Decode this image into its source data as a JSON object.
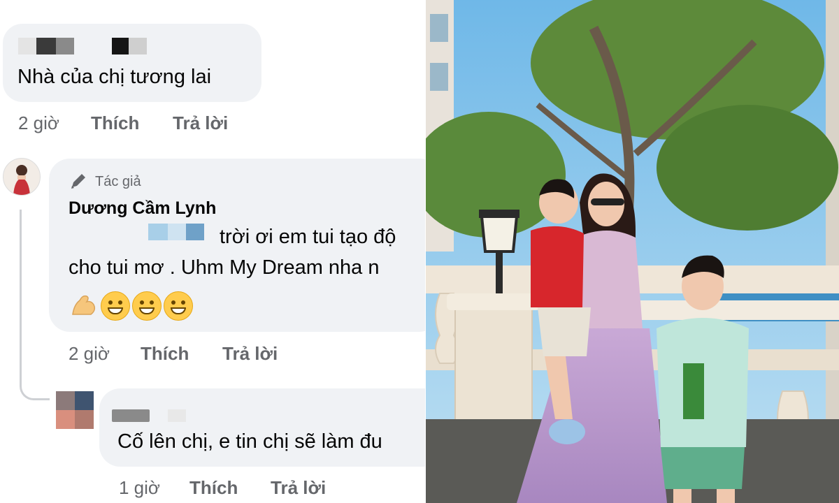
{
  "comments": [
    {
      "text": "Nhà của chị tương lai",
      "time": "2 giờ",
      "like": "Thích",
      "reply": "Trả lời"
    },
    {
      "badge": "Tác giả",
      "author": "Dương Cầm Lynh",
      "line1": "trời ơi em tui tạo độ",
      "line2": "cho tui mơ . Uhm My Dream nha n",
      "time": "2 giờ",
      "like": "Thích",
      "reply": "Trả lời"
    },
    {
      "text": "Cố lên chị, e tin chị sẽ làm đu",
      "time": "1 giờ",
      "like": "Thích",
      "reply": "Trả lời"
    }
  ],
  "emojis": [
    "flexed-biceps",
    "grinning-face",
    "grinning-face",
    "grinning-face"
  ],
  "colors": {
    "bubble": "#f0f2f5",
    "meta": "#65676b",
    "text": "#050505"
  }
}
